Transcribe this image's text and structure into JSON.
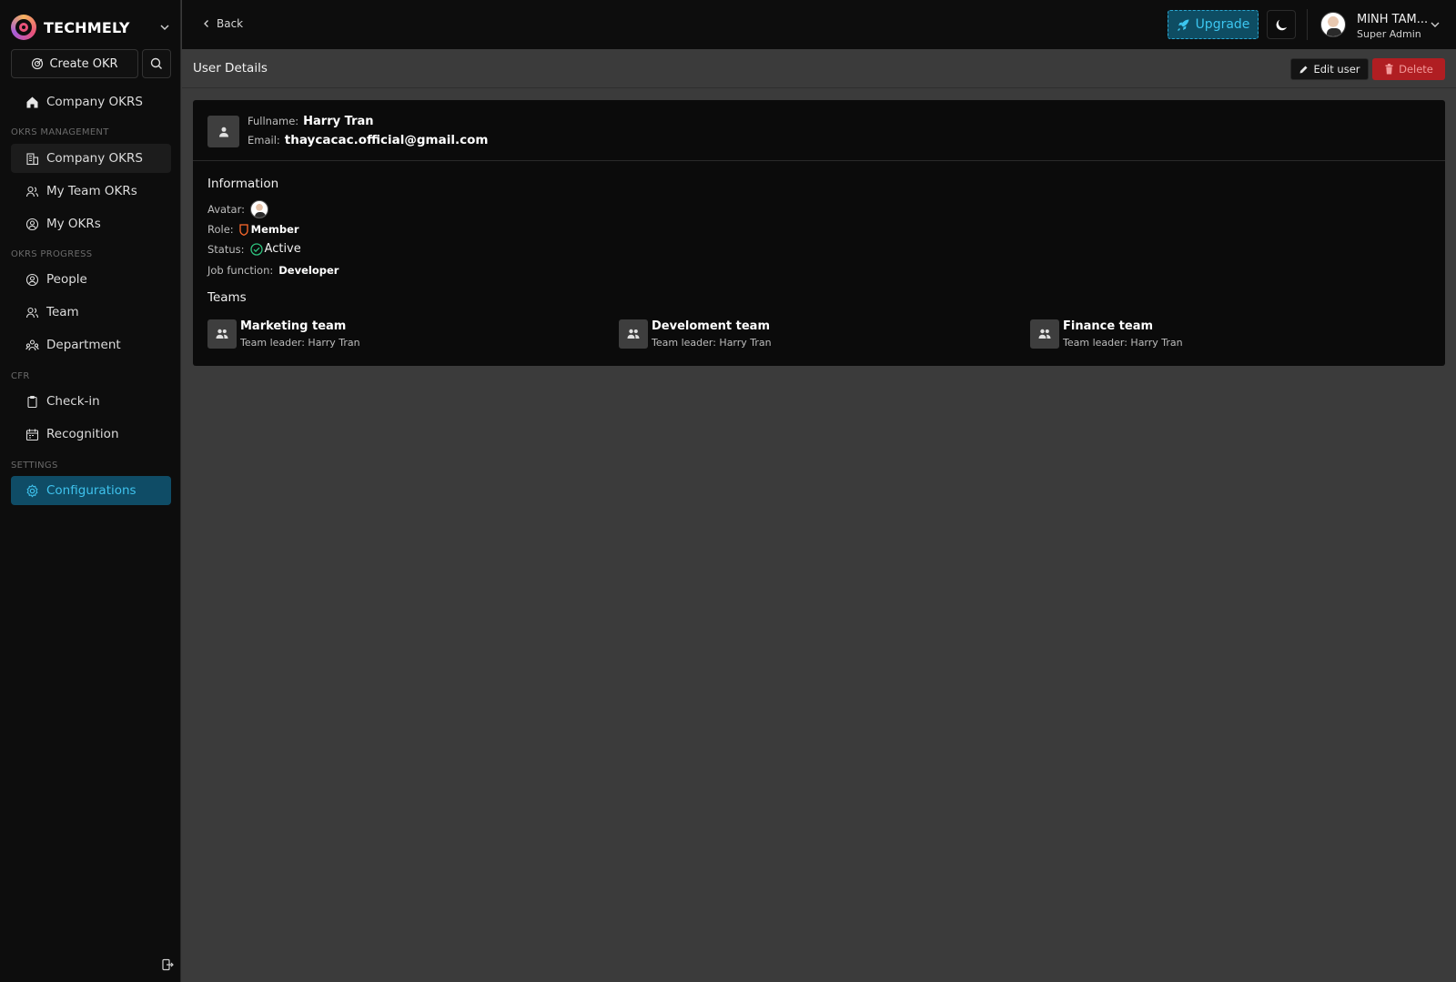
{
  "brand": {
    "name": "TECHMELY"
  },
  "sidebar": {
    "create_label": "Create OKR",
    "home_item": "Company OKRS",
    "sections": [
      {
        "title": "OKRS MANAGEMENT",
        "items": [
          "Company OKRS",
          "My Team OKRs",
          "My OKRs"
        ]
      },
      {
        "title": "OKRS PROGRESS",
        "items": [
          "People",
          "Team",
          "Department"
        ]
      },
      {
        "title": "CFR",
        "items": [
          "Check-in",
          "Recognition"
        ]
      },
      {
        "title": "SETTINGS",
        "items": [
          "Configurations"
        ]
      }
    ]
  },
  "topbar": {
    "back_label": "Back",
    "upgrade_label": "Upgrade",
    "user_name": "MINH TAM...",
    "user_role": "Super Admin"
  },
  "header": {
    "title": "User Details",
    "edit_label": "Edit user",
    "delete_label": "Delete"
  },
  "user": {
    "fullname_label": "Fullname:",
    "fullname": "Harry Tran",
    "email_label": "Email:",
    "email": "thaycacac.official@gmail.com"
  },
  "information": {
    "title": "Information",
    "avatar_label": "Avatar:",
    "role_label": "Role:",
    "role": "Member",
    "status_label": "Status:",
    "status": "Active",
    "job_label": "Job function:",
    "job": "Developer"
  },
  "teams": {
    "title": "Teams",
    "items": [
      {
        "name": "Marketing team",
        "leader": "Team leader: Harry Tran"
      },
      {
        "name": "Develoment team",
        "leader": "Team leader: Harry Tran"
      },
      {
        "name": "Finance team",
        "leader": "Team leader: Harry Tran"
      }
    ]
  },
  "colors": {
    "accent": "#3cc6f0",
    "accent_bg": "#0f4c66",
    "danger": "#b01e22",
    "success": "#2ec27e"
  }
}
